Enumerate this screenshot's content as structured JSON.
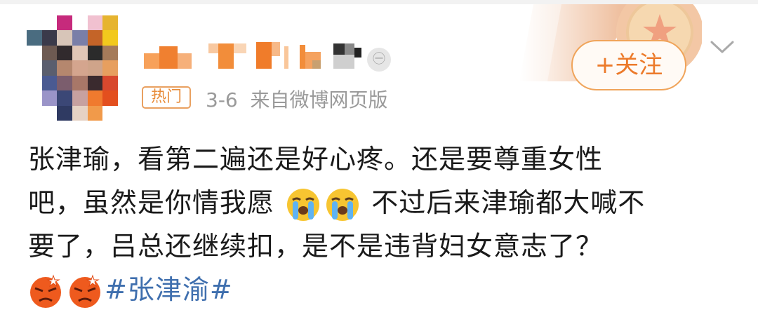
{
  "header": {
    "follow_label": "+关注",
    "badge_text": "㊀"
  },
  "meta": {
    "hot_label": "热门",
    "date": "3-6",
    "source": "来自微博网页版"
  },
  "content": {
    "line1": "张津瑜，看第二遍还是好心疼。还是要尊重女性",
    "line2a": "吧，虽然是你情我愿",
    "line2b": " 不过后来津瑜都大喊不",
    "line3": "要了，吕总还继续扣，是不是违背妇女意志了？",
    "hashtag": "#张津渝#"
  },
  "icons": {
    "avatar": "avatar",
    "badge": "verified-badge-icon",
    "crying": "crying-emoji-icon",
    "angry": "angry-emoji-icon",
    "chevron": "chevron-down-icon"
  },
  "colors": {
    "accent": "#ec7a2a",
    "hashtag": "#3f6fae",
    "meta": "#9a9a9a"
  }
}
